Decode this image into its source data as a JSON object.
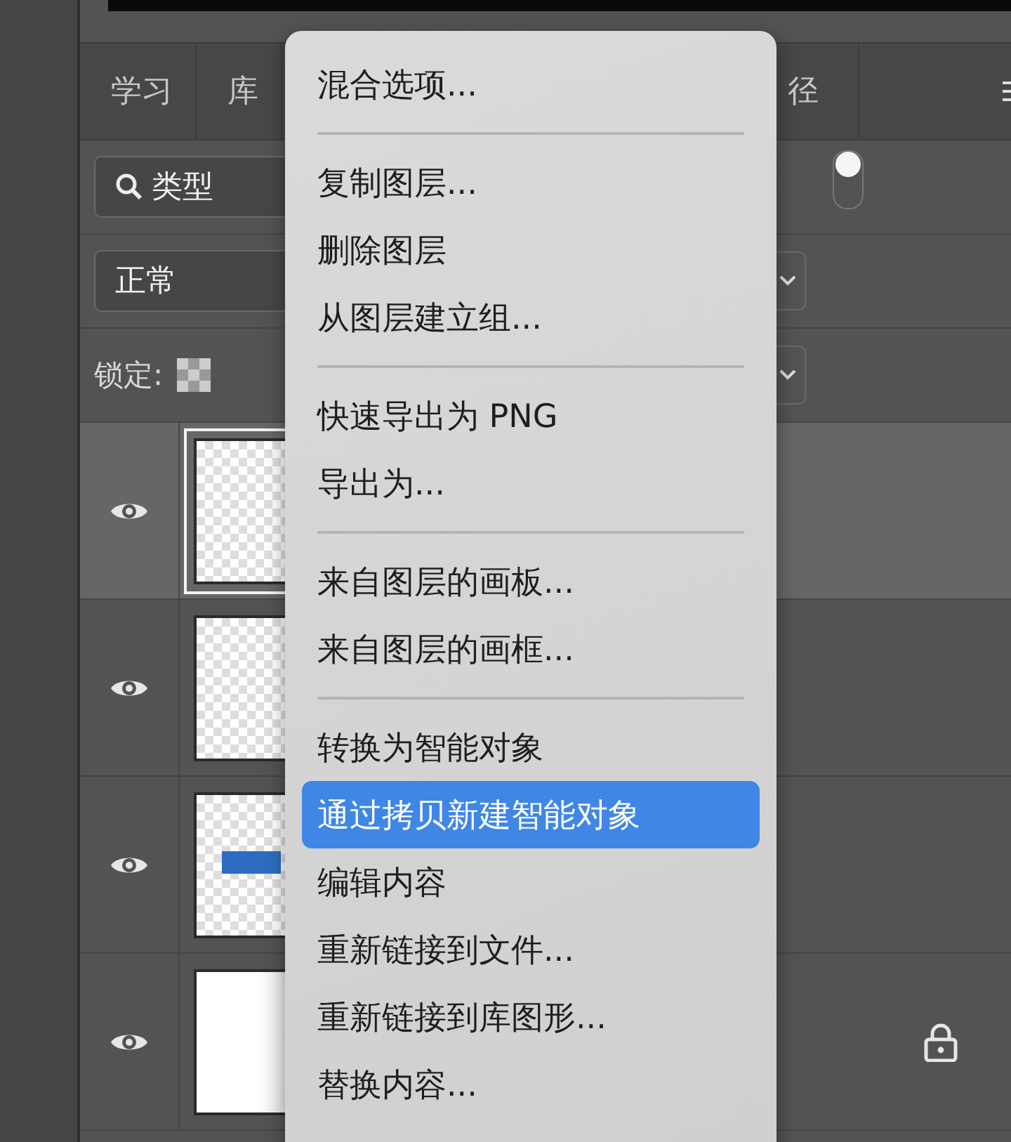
{
  "tabs": [
    {
      "label": "学习"
    },
    {
      "label": "库"
    },
    {
      "label": "径"
    }
  ],
  "filter": {
    "value": "类型",
    "toggle_on": true
  },
  "blend_mode": {
    "value": "正常"
  },
  "lock": {
    "label": "锁定:"
  },
  "layers": [
    {
      "visible": true,
      "selected": true,
      "kind": "empty",
      "locked": false
    },
    {
      "visible": true,
      "selected": false,
      "kind": "empty",
      "locked": false
    },
    {
      "visible": true,
      "selected": false,
      "kind": "shape",
      "locked": false
    },
    {
      "visible": true,
      "selected": false,
      "kind": "fill",
      "locked": true
    }
  ],
  "context_menu": {
    "items": [
      {
        "kind": "item",
        "label": "混合选项...",
        "selected": false
      },
      {
        "kind": "separator"
      },
      {
        "kind": "item",
        "label": "复制图层...",
        "selected": false
      },
      {
        "kind": "item",
        "label": "删除图层",
        "selected": false
      },
      {
        "kind": "item",
        "label": "从图层建立组...",
        "selected": false
      },
      {
        "kind": "separator"
      },
      {
        "kind": "item",
        "label": "快速导出为 PNG",
        "selected": false
      },
      {
        "kind": "item",
        "label": "导出为...",
        "selected": false
      },
      {
        "kind": "separator"
      },
      {
        "kind": "item",
        "label": "来自图层的画板...",
        "selected": false
      },
      {
        "kind": "item",
        "label": "来自图层的画框...",
        "selected": false
      },
      {
        "kind": "separator"
      },
      {
        "kind": "item",
        "label": "转换为智能对象",
        "selected": false
      },
      {
        "kind": "item",
        "label": "通过拷贝新建智能对象",
        "selected": true
      },
      {
        "kind": "item",
        "label": "编辑内容",
        "selected": false
      },
      {
        "kind": "item",
        "label": "重新链接到文件...",
        "selected": false
      },
      {
        "kind": "item",
        "label": "重新链接到库图形...",
        "selected": false
      },
      {
        "kind": "item",
        "label": "替换内容...",
        "selected": false
      }
    ]
  }
}
